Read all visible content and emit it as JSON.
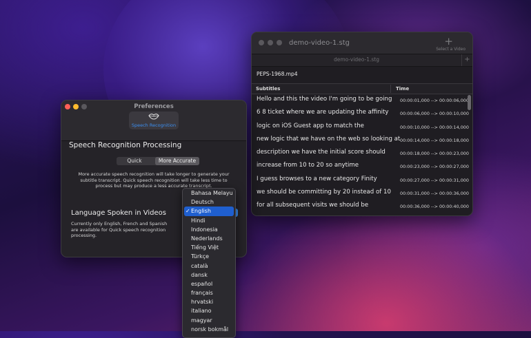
{
  "main_window": {
    "title": "demo-video-1.stg",
    "add_button_label": "Select a Video",
    "tab_label": "demo-video-1.stg",
    "tab_add": "+",
    "file_name": "PEPS-1968.mp4",
    "columns": [
      "Subtitles",
      "Time"
    ],
    "rows": [
      {
        "subtitle": "Hello and this the video I'm going to be going",
        "time": "00:00:01,000 --> 00:00:06,000"
      },
      {
        "subtitle": "6 8 ticket where we are updating the affinity",
        "time": "00:00:06,000 --> 00:00:10,000"
      },
      {
        "subtitle": "logic on iOS Guest app to match the",
        "time": "00:00:10,000 --> 00:00:14,000"
      },
      {
        "subtitle": "new logic that we have on the web so looking at",
        "time": "00:00:14,000 --> 00:00:18,000"
      },
      {
        "subtitle": "description we have the initial score should",
        "time": "00:00:18,000 --> 00:00:23,000"
      },
      {
        "subtitle": "increase from 10 to 20 so anytime",
        "time": "00:00:23,000 --> 00:00:27,000"
      },
      {
        "subtitle": "I guess browses to a new category Finity",
        "time": "00:00:27,000 --> 00:00:31,000"
      },
      {
        "subtitle": "we should be committing by 20 instead of 10",
        "time": "00:00:31,000 --> 00:00:36,000"
      },
      {
        "subtitle": "for all subsequent visits we should be",
        "time": "00:00:36,000 --> 00:00:40,000"
      }
    ]
  },
  "preferences": {
    "title": "Preferences",
    "toolbar_item_label": "Speech Recognition",
    "section_heading": "Speech Recognition Processing",
    "mode_options": [
      "Quick",
      "More Accurate"
    ],
    "selected_mode": "More Accurate",
    "mode_description": "More accurate speech recognition will take longer to generate your subtitle transcript. Quick speech recognition will take less time to process but may produce a less accurate transcript.",
    "language_heading": "Language Spoken in Videos",
    "language_description": "Currently only English, French and Spanish are available for Quick speech recognition processing."
  },
  "language_dropdown": {
    "selected": "English",
    "options": [
      "Bahasa Melayu",
      "Deutsch",
      "English",
      "Hindi",
      "Indonesia",
      "Nederlands",
      "Tiếng Việt",
      "Türkçe",
      "català",
      "dansk",
      "español",
      "français",
      "hrvatski",
      "italiano",
      "magyar",
      "norsk bokmål"
    ]
  },
  "colors": {
    "accent": "#1f5fcf",
    "close": "#ff5f57",
    "minimize": "#febc2e",
    "zoom_inactive": "#5a585d"
  },
  "icons": {
    "speech": "lips-icon",
    "add": "plus-icon",
    "check": "checkmark-icon"
  }
}
